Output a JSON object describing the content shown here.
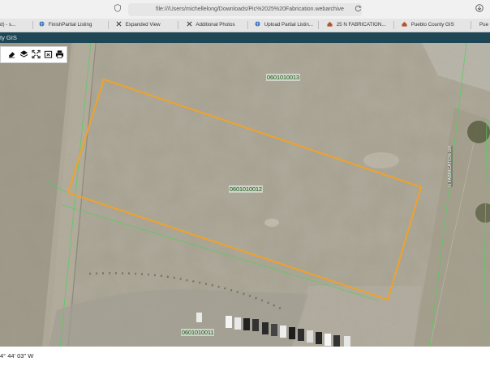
{
  "browser": {
    "url": "file:///Users/michellelong/Downloads/Pic%2025%20Fabrication.webarchive"
  },
  "tabs": [
    {
      "label": "d) - s...",
      "icon": "page-icon"
    },
    {
      "label": "FinishPartial Listing",
      "icon": "globe-icon"
    },
    {
      "label": "Expanded View",
      "icon": "x-logo-icon"
    },
    {
      "label": "Additional Photos",
      "icon": "x-logo-icon"
    },
    {
      "label": "Upload Partial Listin...",
      "icon": "globe-icon"
    },
    {
      "label": "25 N FABRICATION...",
      "icon": "house-icon"
    },
    {
      "label": "Pueblo County GIS",
      "icon": "house-icon"
    },
    {
      "label": "Pue",
      "icon": "page-icon"
    }
  ],
  "gis": {
    "title": "ty GIS"
  },
  "map_toolbar": {
    "tools": [
      "eraser-icon",
      "layers-icon",
      "fullscreen-icon",
      "export-icon",
      "print-icon"
    ]
  },
  "parcels": [
    {
      "id": "0601010013"
    },
    {
      "id": "0601010012"
    },
    {
      "id": "0601010011"
    }
  ],
  "street_label": "N FABRICATION DR",
  "status": {
    "coordinates": "4° 44' 03\" W"
  },
  "colors": {
    "parcel_highlight": "#f0a22a",
    "gis_header": "#1f4654",
    "parcel_line": "#4fd15a"
  }
}
